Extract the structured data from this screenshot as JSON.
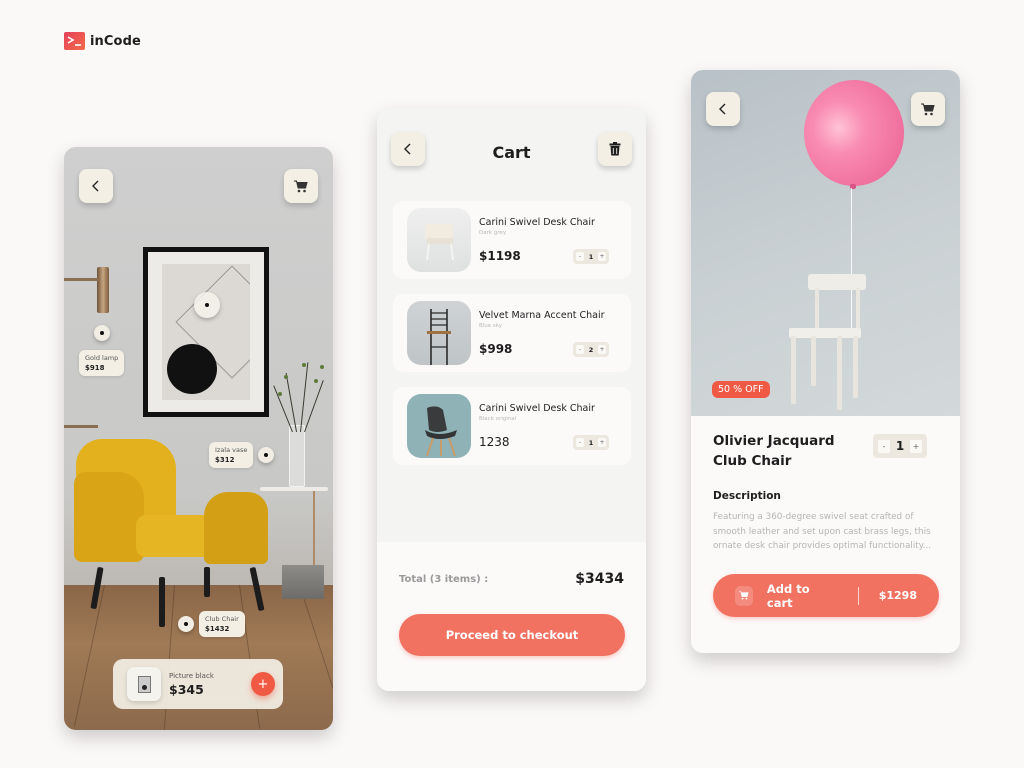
{
  "brand": {
    "name": "inCode",
    "icon": "terminal-prompt-icon"
  },
  "colors": {
    "accent": "#f27262",
    "accent_strong": "#f05a45",
    "background": "#fbf8f8",
    "button_bg": "#f3efe5"
  },
  "screen_room": {
    "back_icon": "chevron-left-icon",
    "cart_icon": "cart-icon",
    "hotspot_tags": [
      {
        "name": "Gold lamp",
        "price": "$918"
      },
      {
        "name": "Izala vase",
        "price": "$312"
      },
      {
        "name": "Club Chair",
        "price": "$1432"
      }
    ],
    "selected_product": {
      "name": "Picture black",
      "price": "$345",
      "add_symbol": "+"
    }
  },
  "screen_cart": {
    "title": "Cart",
    "back_icon": "chevron-left-icon",
    "delete_icon": "trash-icon",
    "items": [
      {
        "name": "Carini Swivel Desk Chair",
        "variant": "Dark grey",
        "price": "$1198",
        "qty": "1"
      },
      {
        "name": "Velvet Marna Accent Chair",
        "variant": "Blue sky",
        "price": "$998",
        "qty": "2"
      },
      {
        "name": "Carini Swivel Desk Chair",
        "variant": "Black original",
        "price": "1238",
        "qty": "1"
      }
    ],
    "stepper": {
      "minus": "-",
      "plus": "+"
    },
    "total_label": "Total (3 items) :",
    "total_value": "$3434",
    "checkout_label": "Proceed to checkout"
  },
  "screen_product": {
    "back_icon": "chevron-left-icon",
    "cart_icon": "cart-icon",
    "discount": "50 % OFF",
    "title": "Olivier Jacquard Club Chair",
    "qty": "1",
    "stepper": {
      "minus": "-",
      "plus": "+"
    },
    "description_heading": "Description",
    "description": "Featuring a 360-degree swivel seat crafted of smooth leather and set upon cast brass legs, this ornate desk chair provides optimal functionality...",
    "add_label": "Add to cart",
    "add_price": "$1298"
  }
}
